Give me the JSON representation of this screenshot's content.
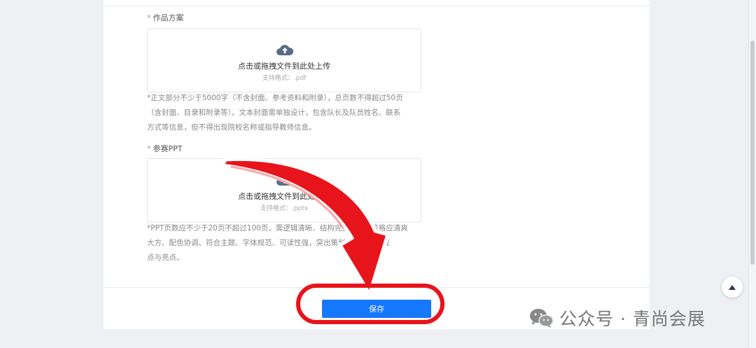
{
  "form": {
    "field1": {
      "label": "作品方案",
      "upload_title": "点击或拖拽文件到此处上传",
      "upload_sub": "支持格式：.pdf",
      "hint_lines": [
        "*正文部分不少于5000字（不含封面、参考资料和附录），总页数不得超过50页",
        "（含封面、目录和附录等）。文本封面需单独设计，包含队长及队员姓名、联系",
        "方式等信息，但不得出现院校名称或指导教师信息。"
      ]
    },
    "field2": {
      "label": "参赛PPT",
      "upload_title": "点击或拖拽文件到此处上传",
      "upload_sub": "支持格式：.pptx",
      "hint_lines": [
        "*PPT页数应不少于20页不超过100页，需逻辑清晰、结构完整，设计风格应清爽",
        "大方、配色协调、符合主题、字体规范、可读性强，突出策划方案的核心观",
        "点与亮点。"
      ]
    },
    "save_label": "保存"
  },
  "watermark": {
    "text": "公众号 · 青尚会展",
    "icon": "wechat-icon"
  },
  "back_to_top_icon": "chevron-up-icon",
  "colors": {
    "primary": "#1677ff",
    "annotation_red": "#e8141b",
    "upload_icon": "#5b6b87"
  }
}
